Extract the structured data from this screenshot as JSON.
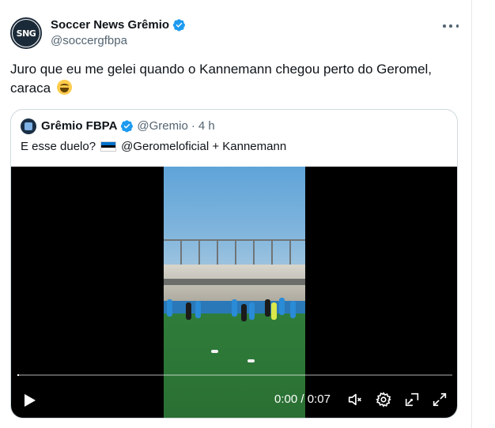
{
  "tweet": {
    "author_name": "Soccer News Grêmio",
    "author_handle": "@soccergfbpa",
    "avatar_text": "SNG",
    "text": "Juro que eu me gelei quando o Kannemann chegou perto do Geromel, caraca",
    "emoji": "face-with-tears-of-joy"
  },
  "quoted": {
    "author_name": "Grêmio FBPA",
    "author_handle": "@Gremio",
    "separator": "·",
    "time": "4 h",
    "text_before": "E esse duelo?",
    "flag": "estonia-flag",
    "text_after": "@Geromeloficial + Kannemann"
  },
  "video": {
    "progress": 0,
    "time_current": "0:00",
    "time_sep": " / ",
    "time_total": "0:07",
    "controls": [
      "play-icon",
      "mute-icon",
      "settings-icon",
      "pip-icon",
      "fullscreen-icon"
    ]
  },
  "colors": {
    "verified": "#1d9bf0",
    "text_primary": "#0f1419",
    "text_secondary": "#536471",
    "border": "#cfd9de"
  }
}
